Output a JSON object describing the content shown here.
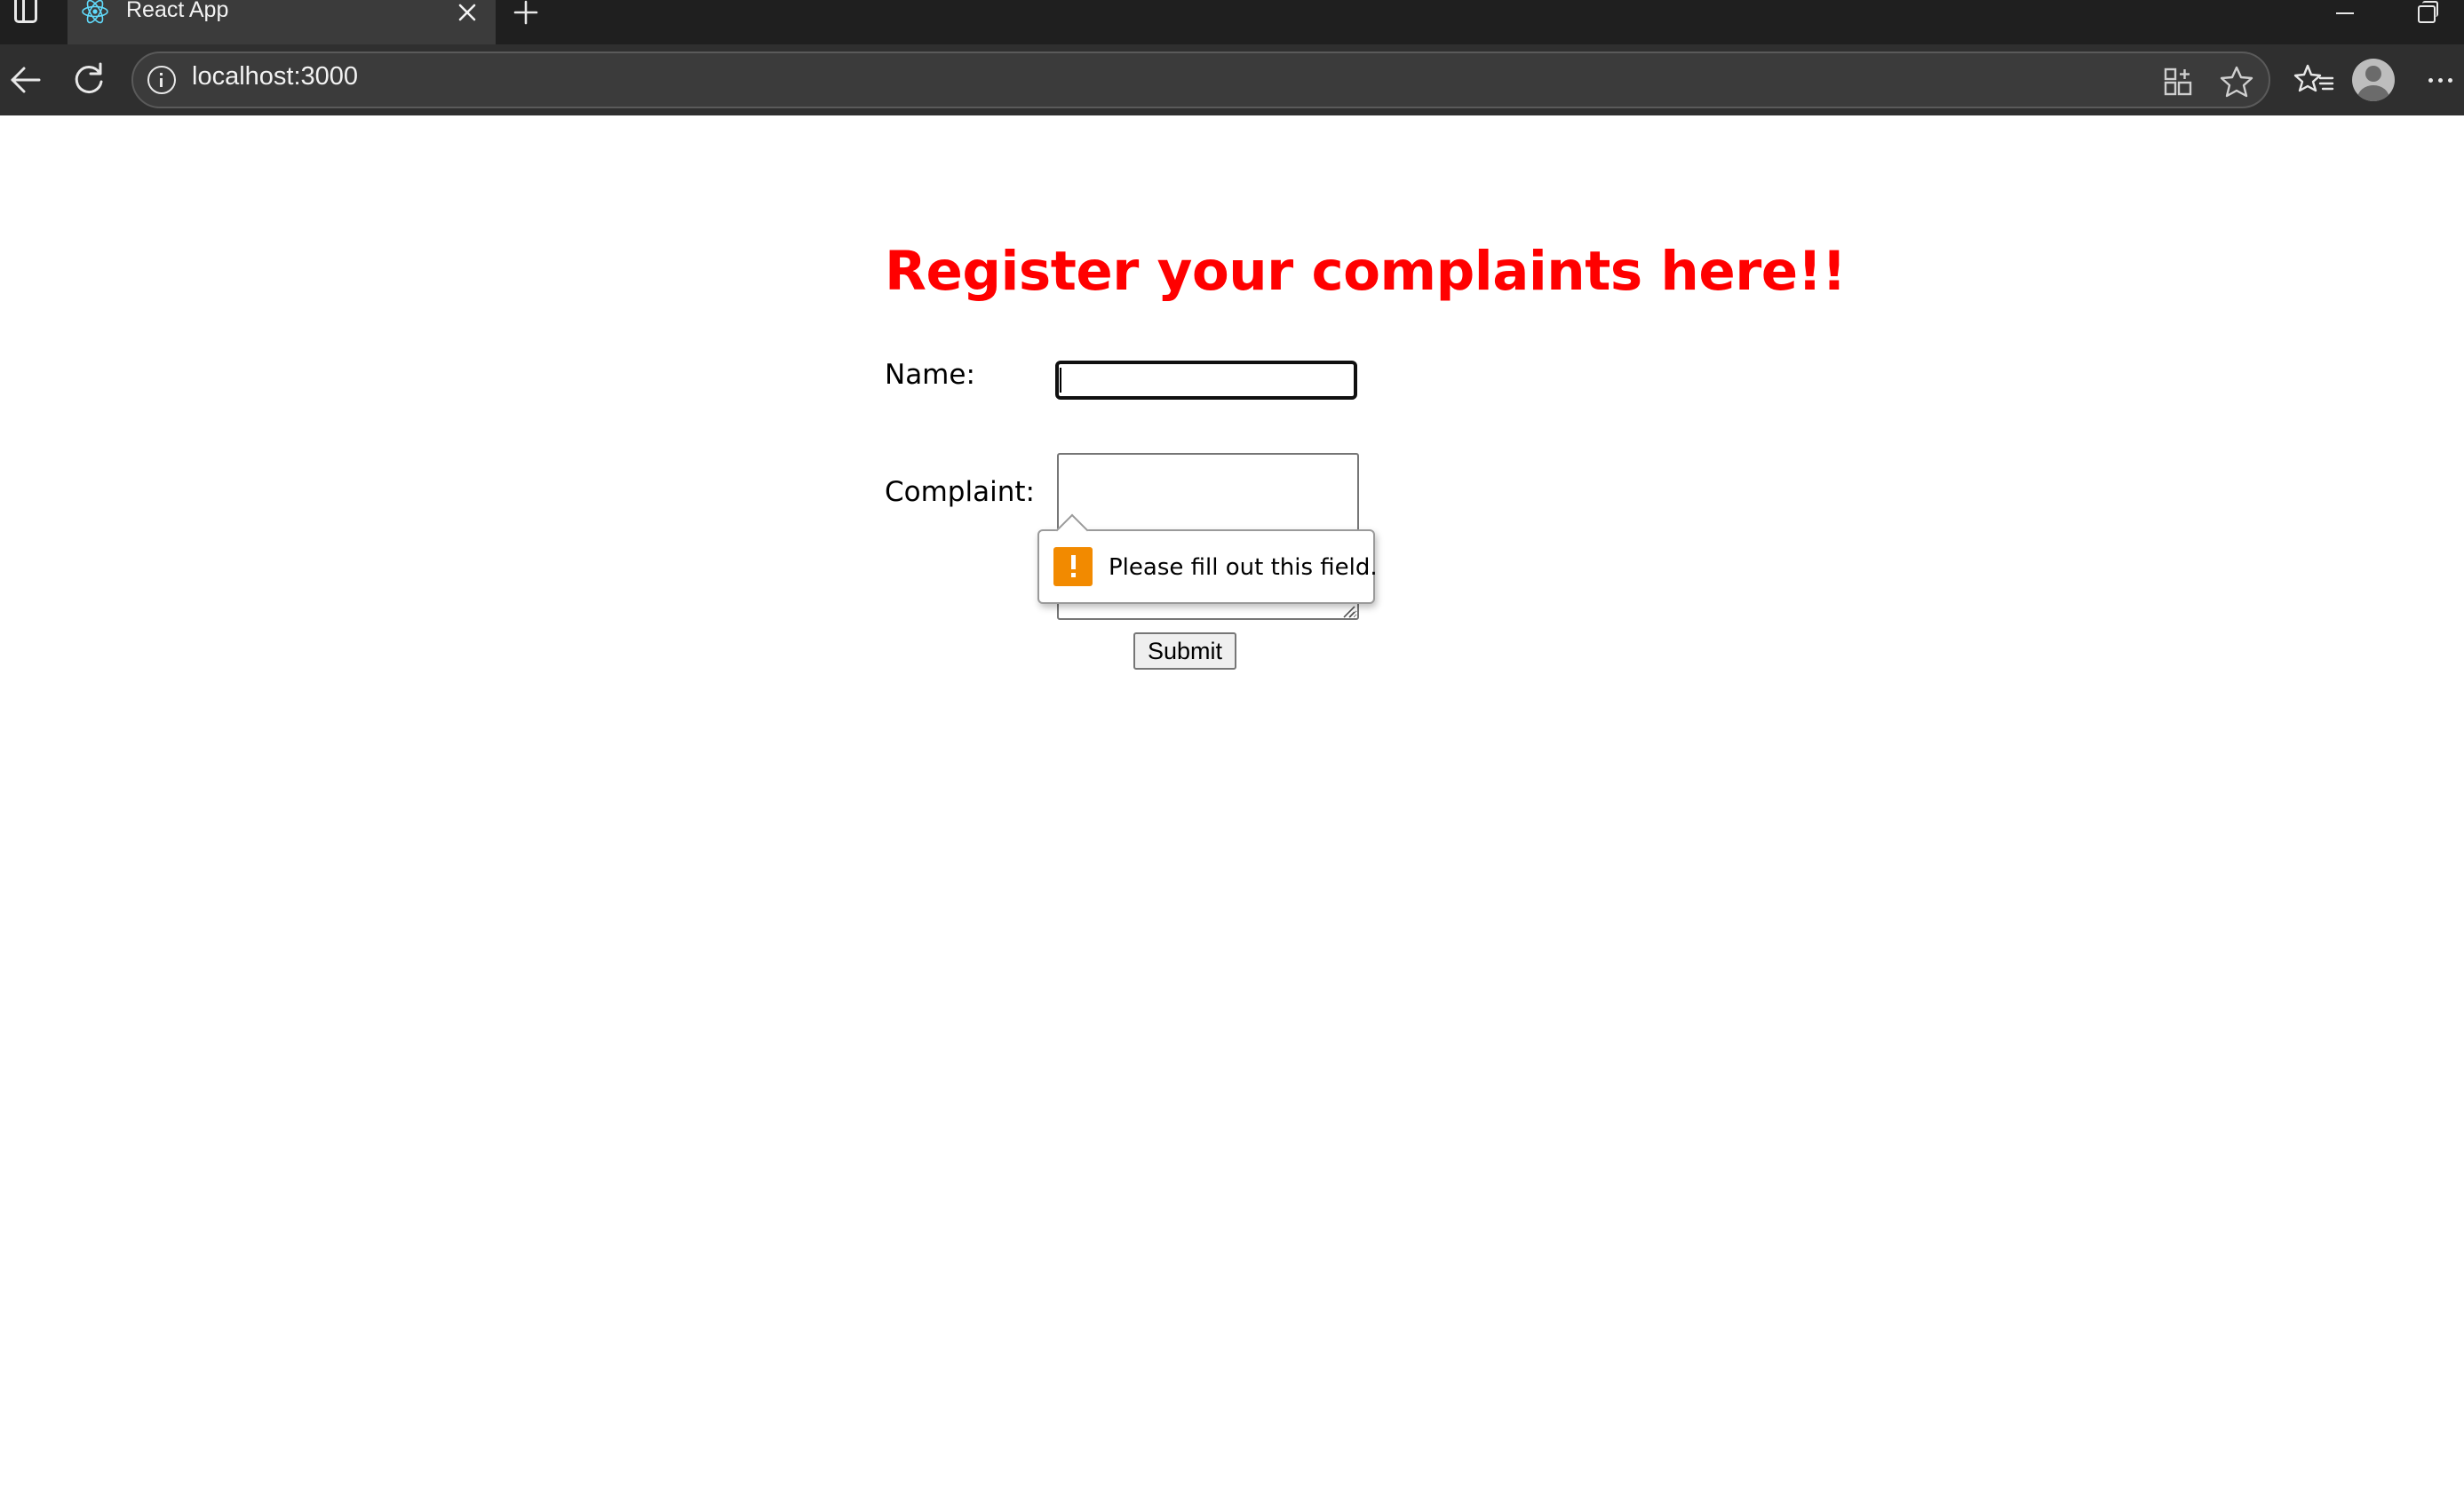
{
  "browser": {
    "tab": {
      "title": "React App",
      "icon": "react-icon"
    },
    "address_bar": {
      "url": "localhost:3000"
    },
    "icons": {
      "back": "back-arrow-icon",
      "reload": "reload-icon",
      "site_info": "info-icon",
      "split_screen": "app-available-icon",
      "favorite": "star-icon",
      "favorites": "favorites-icon",
      "profile": "profile-avatar-icon",
      "more": "more-icon"
    }
  },
  "page": {
    "heading": "Register your complaints here!!",
    "form": {
      "name_label": "Name:",
      "name_value": "",
      "complaint_label": "Complaint:",
      "complaint_value": "",
      "submit_label": "Submit"
    },
    "validation_tooltip": {
      "message": "Please fill out this field.",
      "icon": "warning-icon"
    }
  },
  "colors": {
    "heading": "#ff0000",
    "browser_frame": "#1f1f1f",
    "toolbar": "#2f2f2f",
    "warning_icon": "#f28a00"
  }
}
